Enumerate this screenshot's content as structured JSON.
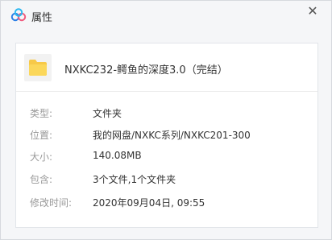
{
  "window": {
    "title": "属性",
    "close_symbol": "✕",
    "app_icon": "baidu-netdisk-logo-icon"
  },
  "file": {
    "icon": "folder-icon",
    "name": "NXKC232-鳄鱼的深度3.0（完结）"
  },
  "properties": [
    {
      "label": "类型:",
      "value": "文件夹"
    },
    {
      "label": "位置:",
      "value": "我的网盘/NXKC系列/NXKC201-300"
    },
    {
      "label": "大小:",
      "value": "140.08MB"
    },
    {
      "label": "包含:",
      "value": "3个文件,1个文件夹"
    },
    {
      "label": "修改时间:",
      "value": "2020年09月04日, 09:55"
    }
  ],
  "colors": {
    "folder": "#f7c948",
    "label": "#999999",
    "value": "#333333",
    "logo_blue": "#2b7fe6",
    "logo_pink": "#f05a7e"
  }
}
